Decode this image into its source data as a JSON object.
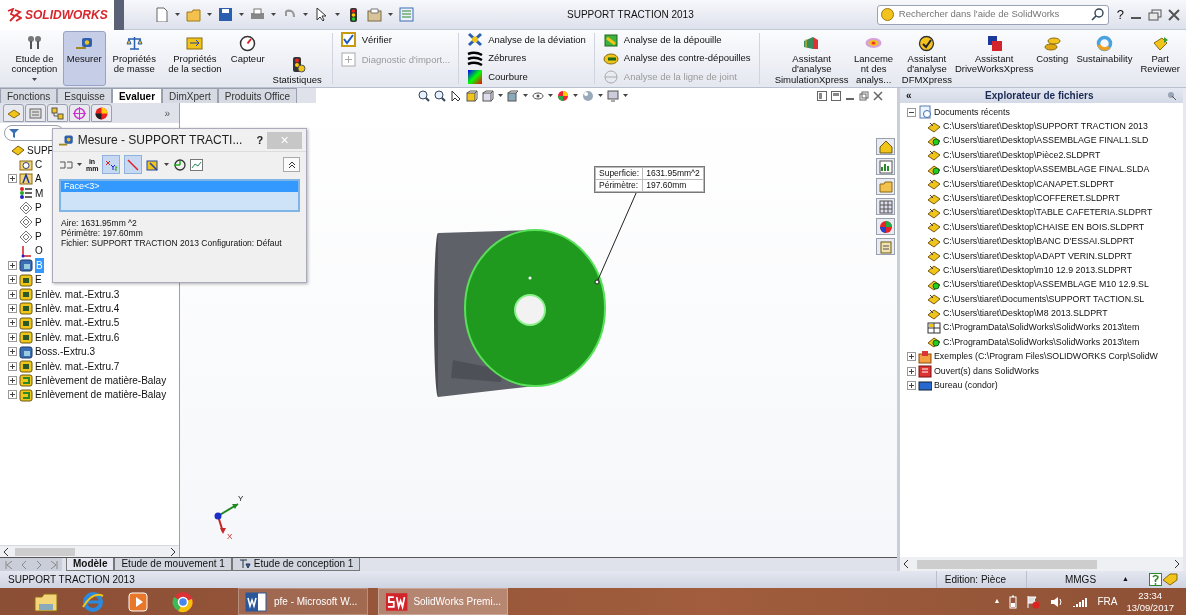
{
  "title_bar": {
    "logo": "SOLIDWORKS",
    "document_title": "SUPPORT TRACTION 2013",
    "search": {
      "placeholder": "Rechercher dans l'aide de SolidWorks"
    },
    "help": "?"
  },
  "ribbon": {
    "groups": [
      {
        "kind": "large",
        "items": [
          {
            "label": "Etude de conception",
            "selected": false,
            "dropdown": true
          },
          {
            "label": "Mesurer",
            "selected": true,
            "dropdown": false
          },
          {
            "label": "Propriétés de masse",
            "selected": false,
            "dropdown": false
          },
          {
            "label": "Propriétés de la section",
            "selected": false,
            "dropdown": false
          },
          {
            "label": "Capteur",
            "selected": false,
            "dropdown": false
          },
          {
            "label": "Statistiques",
            "selected": false,
            "dropdown": false
          }
        ]
      },
      {
        "kind": "stack",
        "items": [
          {
            "label": "Vérifier",
            "disabled": false
          },
          {
            "label": "Diagnostic d'import...",
            "disabled": true
          }
        ]
      },
      {
        "kind": "stack",
        "items": [
          {
            "label": "Analyse de la déviation",
            "disabled": false
          },
          {
            "label": "Zébrures",
            "disabled": false
          },
          {
            "label": "Courbure",
            "disabled": false
          }
        ]
      },
      {
        "kind": "stack",
        "items": [
          {
            "label": "Analyse de la dépouille",
            "disabled": false
          },
          {
            "label": "Analyse des contre-dépouilles",
            "disabled": false
          },
          {
            "label": "Analyse de la ligne de joint",
            "disabled": true
          }
        ]
      },
      {
        "kind": "large",
        "items": [
          {
            "label": "Assistant d'analyse SimulationXpress",
            "selected": false,
            "dropdown": false
          },
          {
            "label": "Lanceme nt des analys...",
            "selected": false,
            "dropdown": false
          },
          {
            "label": "Assistant d'analyse DFMXpress",
            "selected": false,
            "dropdown": false
          },
          {
            "label": "Assistant DriveWorksXpress",
            "selected": false,
            "dropdown": false
          },
          {
            "label": "Costing",
            "selected": false,
            "dropdown": false
          },
          {
            "label": "Sustainability",
            "selected": false,
            "dropdown": false
          },
          {
            "label": "Part Reviewer",
            "selected": false,
            "dropdown": false
          }
        ]
      }
    ]
  },
  "command_tabs": [
    {
      "label": "Fonctions",
      "selected": false
    },
    {
      "label": "Esquisse",
      "selected": false
    },
    {
      "label": "Evaluer",
      "selected": true
    },
    {
      "label": "DimXpert",
      "selected": false
    },
    {
      "label": "Produits Office",
      "selected": false
    }
  ],
  "feature_tree": {
    "more": "»",
    "items": [
      {
        "label": "SUPP",
        "kind": "part",
        "expandable": false
      },
      {
        "label": "C",
        "kind": "sensors",
        "expandable": false
      },
      {
        "label": "A",
        "kind": "annotations",
        "expandable": true
      },
      {
        "label": "M",
        "kind": "material",
        "expandable": false
      },
      {
        "label": "P",
        "kind": "plane",
        "expandable": false
      },
      {
        "label": "P",
        "kind": "plane",
        "expandable": false
      },
      {
        "label": "P",
        "kind": "plane",
        "expandable": false
      },
      {
        "label": "O",
        "kind": "origin",
        "expandable": false
      },
      {
        "label": "B",
        "kind": "boss",
        "expandable": true,
        "selected": true
      },
      {
        "label": "E",
        "kind": "cut",
        "expandable": true
      },
      {
        "label": "Enlèv. mat.-Extru.3",
        "kind": "cut",
        "expandable": true
      },
      {
        "label": "Enlèv. mat.-Extru.4",
        "kind": "cut",
        "expandable": true
      },
      {
        "label": "Enlèv. mat.-Extru.5",
        "kind": "cut",
        "expandable": true
      },
      {
        "label": "Enlèv. mat.-Extru.6",
        "kind": "cut",
        "expandable": true
      },
      {
        "label": "Boss.-Extru.3",
        "kind": "boss",
        "expandable": true
      },
      {
        "label": "Enlèv. mat.-Extru.7",
        "kind": "cut",
        "expandable": true
      },
      {
        "label": "Enlèvement de matière-Balay",
        "kind": "sweep",
        "expandable": true
      },
      {
        "label": "Enlèvement de matière-Balay",
        "kind": "sweep",
        "expandable": true
      }
    ]
  },
  "measure_dialog": {
    "title": "Mesure - SUPPORT TRACTI...",
    "help": "?",
    "close": "×",
    "units": "in mm",
    "selections": [
      {
        "label": "Face<3>",
        "selected": true
      }
    ],
    "results": [
      "Aire: 1631.95mm ^2",
      "Périmètre: 197.60mm",
      "Fichier: SUPPORT TRACTION 2013 Configuration: Défaut"
    ]
  },
  "viewport": {
    "callout": [
      {
        "label": "Superficie:",
        "value": "1631.95mm^2"
      },
      {
        "label": "Périmètre:",
        "value": "197.60mm"
      }
    ],
    "triad": {
      "y": "Y",
      "x": "X"
    }
  },
  "file_explorer": {
    "collapse": "«",
    "title": "Explorateur de fichiers",
    "items": [
      {
        "label": "Documents récents",
        "kind": "recent",
        "expanded": true,
        "children": [
          {
            "label": "C:\\Users\\tiaret\\Desktop\\SUPPORT TRACTION 2013",
            "kind": "part"
          },
          {
            "label": "C:\\Users\\tiaret\\Desktop\\ASSEMBLAGE FINAL1.SLD",
            "kind": "assembly"
          },
          {
            "label": "C:\\Users\\tiaret\\Desktop\\Pièce2.SLDPRT",
            "kind": "part"
          },
          {
            "label": "C:\\Users\\tiaret\\Desktop\\ASSEMBLAGE FINAL.SLDA",
            "kind": "assembly"
          },
          {
            "label": "C:\\Users\\tiaret\\Desktop\\CANAPET.SLDPRT",
            "kind": "part"
          },
          {
            "label": "C:\\Users\\tiaret\\Desktop\\COFFERET.SLDPRT",
            "kind": "part"
          },
          {
            "label": "C:\\Users\\tiaret\\Desktop\\TABLE CAFETERIA.SLDPRT",
            "kind": "part"
          },
          {
            "label": "C:\\Users\\tiaret\\Desktop\\CHAISE EN BOIS.SLDPRT",
            "kind": "part"
          },
          {
            "label": "C:\\Users\\tiaret\\Desktop\\BANC D'ESSAI.SLDPRT",
            "kind": "part"
          },
          {
            "label": "C:\\Users\\tiaret\\Desktop\\ADAPT VERIN.SLDPRT",
            "kind": "part"
          },
          {
            "label": "C:\\Users\\tiaret\\Desktop\\m10 12.9 2013.SLDPRT",
            "kind": "part"
          },
          {
            "label": "C:\\Users\\tiaret\\Desktop\\ASSEMBLAGE M10 12.9.SL",
            "kind": "assembly"
          },
          {
            "label": "C:\\Users\\tiaret\\Documents\\SUPPORT TACTION.SL",
            "kind": "part"
          },
          {
            "label": "C:\\Users\\tiaret\\Desktop\\M8 2013.SLDPRT",
            "kind": "part"
          },
          {
            "label": "C:\\ProgramData\\SolidWorks\\SolidWorks 2013\\tem",
            "kind": "drawing"
          },
          {
            "label": "C:\\ProgramData\\SolidWorks\\SolidWorks 2013\\tem",
            "kind": "assembly"
          }
        ]
      },
      {
        "label": "Exemples (C:\\Program Files\\SOLIDWORKS Corp\\SolidW",
        "kind": "examples",
        "expanded": false
      },
      {
        "label": "Ouvert(s) dans SolidWorks",
        "kind": "open",
        "expanded": false
      },
      {
        "label": "Bureau (condor)",
        "kind": "desktop",
        "expanded": false
      }
    ]
  },
  "bottom_tabs": [
    {
      "label": "Modèle",
      "selected": true
    },
    {
      "label": "Etude de mouvement 1",
      "selected": false
    },
    {
      "label": "Etude de conception 1",
      "selected": false
    }
  ],
  "status_bar": {
    "document": "SUPPORT TRACTION 2013",
    "mode": "Edition: Pièce",
    "units": "MMGS",
    "arrow": "▲"
  },
  "taskbar": {
    "windows": [
      {
        "label": "pfe - Microsoft W...",
        "selected": false
      },
      {
        "label": "SolidWorks Premi...",
        "selected": true
      }
    ],
    "tray_arrow": "▲",
    "language": "FRA",
    "time": "23:34",
    "date": "13/09/2017"
  }
}
